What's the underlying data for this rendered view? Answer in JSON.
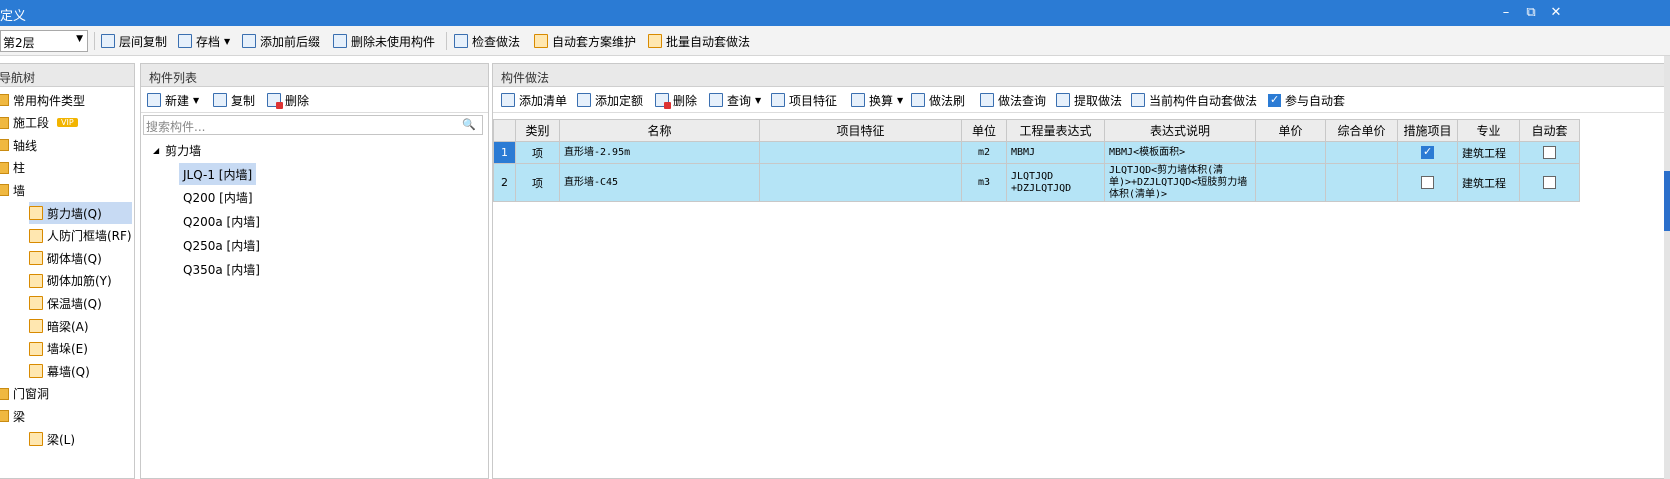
{
  "window": {
    "title": "定义",
    "btn_min": "–",
    "btn_restore": "⧉",
    "btn_close": "✕"
  },
  "toolbar": {
    "floor": "第2层",
    "items": [
      "层间复制",
      "存档",
      "添加前后缀",
      "删除未使用构件",
      "检查做法",
      "自动套方案维护",
      "批量自动套做法"
    ]
  },
  "nav": {
    "title": "导航树",
    "items": [
      {
        "label": "常用构件类型",
        "level": 0
      },
      {
        "label": "施工段",
        "level": 0,
        "badge": "VIP"
      },
      {
        "label": "轴线",
        "level": 0
      },
      {
        "label": "柱",
        "level": 0
      },
      {
        "label": "墙",
        "level": 0
      },
      {
        "label": "剪力墙(Q)",
        "level": 1,
        "selected": true
      },
      {
        "label": "人防门框墙(RF)",
        "level": 1
      },
      {
        "label": "砌体墙(Q)",
        "level": 1
      },
      {
        "label": "砌体加筋(Y)",
        "level": 1
      },
      {
        "label": "保温墙(Q)",
        "level": 1
      },
      {
        "label": "暗梁(A)",
        "level": 1
      },
      {
        "label": "墙垛(E)",
        "level": 1
      },
      {
        "label": "幕墙(Q)",
        "level": 1
      },
      {
        "label": "门窗洞",
        "level": 0
      },
      {
        "label": "梁",
        "level": 0
      },
      {
        "label": "梁(L)",
        "level": 1
      }
    ]
  },
  "component_list": {
    "title": "构件列表",
    "actions": [
      "新建",
      "复制",
      "删除"
    ],
    "search_placeholder": "搜索构件...",
    "root": "剪力墙",
    "items": [
      {
        "label": "JLQ-1 [内墙]",
        "selected": true
      },
      {
        "label": "Q200 [内墙]"
      },
      {
        "label": "Q200a [内墙]"
      },
      {
        "label": "Q250a [内墙]"
      },
      {
        "label": "Q350a [内墙]"
      }
    ]
  },
  "method": {
    "title": "构件做法",
    "actions": [
      "添加清单",
      "添加定额",
      "删除",
      "查询",
      "项目特征",
      "换算",
      "做法刷",
      "做法查询",
      "提取做法",
      "当前构件自动套做法",
      "参与自动套"
    ],
    "columns": [
      "类别",
      "名称",
      "项目特征",
      "单位",
      "工程量表达式",
      "表达式说明",
      "单价",
      "综合单价",
      "措施项目",
      "专业",
      "自动套"
    ],
    "rows": [
      {
        "no": "1",
        "type": "项",
        "name": "直形墙-2.95m",
        "feature": "",
        "unit": "m2",
        "expr": "MBMJ",
        "desc": "MBMJ<模板面积>",
        "price": "",
        "total": "",
        "measure": true,
        "major": "建筑工程",
        "auto": false
      },
      {
        "no": "2",
        "type": "项",
        "name": "直形墙-C45",
        "feature": "",
        "unit": "m3",
        "expr": "JLQTJQD +DZJLQTJQD",
        "desc": "JLQTJQD<剪力墙体积(清单)>+DZJLQTJQD<短肢剪力墙体积(清单)>",
        "price": "",
        "total": "",
        "measure": false,
        "major": "建筑工程",
        "auto": false
      }
    ]
  }
}
